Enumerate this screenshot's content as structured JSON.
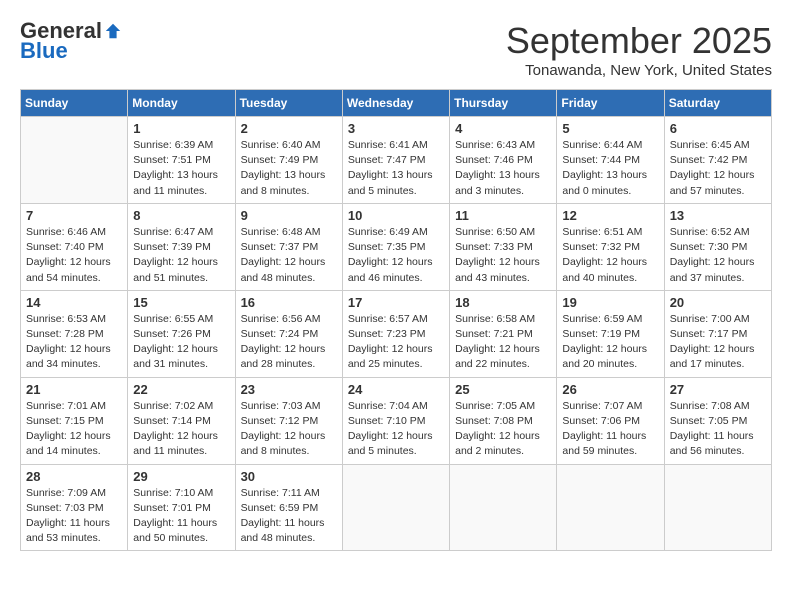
{
  "logo": {
    "general": "General",
    "blue": "Blue"
  },
  "title": "September 2025",
  "subtitle": "Tonawanda, New York, United States",
  "days_of_week": [
    "Sunday",
    "Monday",
    "Tuesday",
    "Wednesday",
    "Thursday",
    "Friday",
    "Saturday"
  ],
  "weeks": [
    [
      {
        "day": "",
        "info": ""
      },
      {
        "day": "1",
        "info": "Sunrise: 6:39 AM\nSunset: 7:51 PM\nDaylight: 13 hours\nand 11 minutes."
      },
      {
        "day": "2",
        "info": "Sunrise: 6:40 AM\nSunset: 7:49 PM\nDaylight: 13 hours\nand 8 minutes."
      },
      {
        "day": "3",
        "info": "Sunrise: 6:41 AM\nSunset: 7:47 PM\nDaylight: 13 hours\nand 5 minutes."
      },
      {
        "day": "4",
        "info": "Sunrise: 6:43 AM\nSunset: 7:46 PM\nDaylight: 13 hours\nand 3 minutes."
      },
      {
        "day": "5",
        "info": "Sunrise: 6:44 AM\nSunset: 7:44 PM\nDaylight: 13 hours\nand 0 minutes."
      },
      {
        "day": "6",
        "info": "Sunrise: 6:45 AM\nSunset: 7:42 PM\nDaylight: 12 hours\nand 57 minutes."
      }
    ],
    [
      {
        "day": "7",
        "info": "Sunrise: 6:46 AM\nSunset: 7:40 PM\nDaylight: 12 hours\nand 54 minutes."
      },
      {
        "day": "8",
        "info": "Sunrise: 6:47 AM\nSunset: 7:39 PM\nDaylight: 12 hours\nand 51 minutes."
      },
      {
        "day": "9",
        "info": "Sunrise: 6:48 AM\nSunset: 7:37 PM\nDaylight: 12 hours\nand 48 minutes."
      },
      {
        "day": "10",
        "info": "Sunrise: 6:49 AM\nSunset: 7:35 PM\nDaylight: 12 hours\nand 46 minutes."
      },
      {
        "day": "11",
        "info": "Sunrise: 6:50 AM\nSunset: 7:33 PM\nDaylight: 12 hours\nand 43 minutes."
      },
      {
        "day": "12",
        "info": "Sunrise: 6:51 AM\nSunset: 7:32 PM\nDaylight: 12 hours\nand 40 minutes."
      },
      {
        "day": "13",
        "info": "Sunrise: 6:52 AM\nSunset: 7:30 PM\nDaylight: 12 hours\nand 37 minutes."
      }
    ],
    [
      {
        "day": "14",
        "info": "Sunrise: 6:53 AM\nSunset: 7:28 PM\nDaylight: 12 hours\nand 34 minutes."
      },
      {
        "day": "15",
        "info": "Sunrise: 6:55 AM\nSunset: 7:26 PM\nDaylight: 12 hours\nand 31 minutes."
      },
      {
        "day": "16",
        "info": "Sunrise: 6:56 AM\nSunset: 7:24 PM\nDaylight: 12 hours\nand 28 minutes."
      },
      {
        "day": "17",
        "info": "Sunrise: 6:57 AM\nSunset: 7:23 PM\nDaylight: 12 hours\nand 25 minutes."
      },
      {
        "day": "18",
        "info": "Sunrise: 6:58 AM\nSunset: 7:21 PM\nDaylight: 12 hours\nand 22 minutes."
      },
      {
        "day": "19",
        "info": "Sunrise: 6:59 AM\nSunset: 7:19 PM\nDaylight: 12 hours\nand 20 minutes."
      },
      {
        "day": "20",
        "info": "Sunrise: 7:00 AM\nSunset: 7:17 PM\nDaylight: 12 hours\nand 17 minutes."
      }
    ],
    [
      {
        "day": "21",
        "info": "Sunrise: 7:01 AM\nSunset: 7:15 PM\nDaylight: 12 hours\nand 14 minutes."
      },
      {
        "day": "22",
        "info": "Sunrise: 7:02 AM\nSunset: 7:14 PM\nDaylight: 12 hours\nand 11 minutes."
      },
      {
        "day": "23",
        "info": "Sunrise: 7:03 AM\nSunset: 7:12 PM\nDaylight: 12 hours\nand 8 minutes."
      },
      {
        "day": "24",
        "info": "Sunrise: 7:04 AM\nSunset: 7:10 PM\nDaylight: 12 hours\nand 5 minutes."
      },
      {
        "day": "25",
        "info": "Sunrise: 7:05 AM\nSunset: 7:08 PM\nDaylight: 12 hours\nand 2 minutes."
      },
      {
        "day": "26",
        "info": "Sunrise: 7:07 AM\nSunset: 7:06 PM\nDaylight: 11 hours\nand 59 minutes."
      },
      {
        "day": "27",
        "info": "Sunrise: 7:08 AM\nSunset: 7:05 PM\nDaylight: 11 hours\nand 56 minutes."
      }
    ],
    [
      {
        "day": "28",
        "info": "Sunrise: 7:09 AM\nSunset: 7:03 PM\nDaylight: 11 hours\nand 53 minutes."
      },
      {
        "day": "29",
        "info": "Sunrise: 7:10 AM\nSunset: 7:01 PM\nDaylight: 11 hours\nand 50 minutes."
      },
      {
        "day": "30",
        "info": "Sunrise: 7:11 AM\nSunset: 6:59 PM\nDaylight: 11 hours\nand 48 minutes."
      },
      {
        "day": "",
        "info": ""
      },
      {
        "day": "",
        "info": ""
      },
      {
        "day": "",
        "info": ""
      },
      {
        "day": "",
        "info": ""
      }
    ]
  ]
}
